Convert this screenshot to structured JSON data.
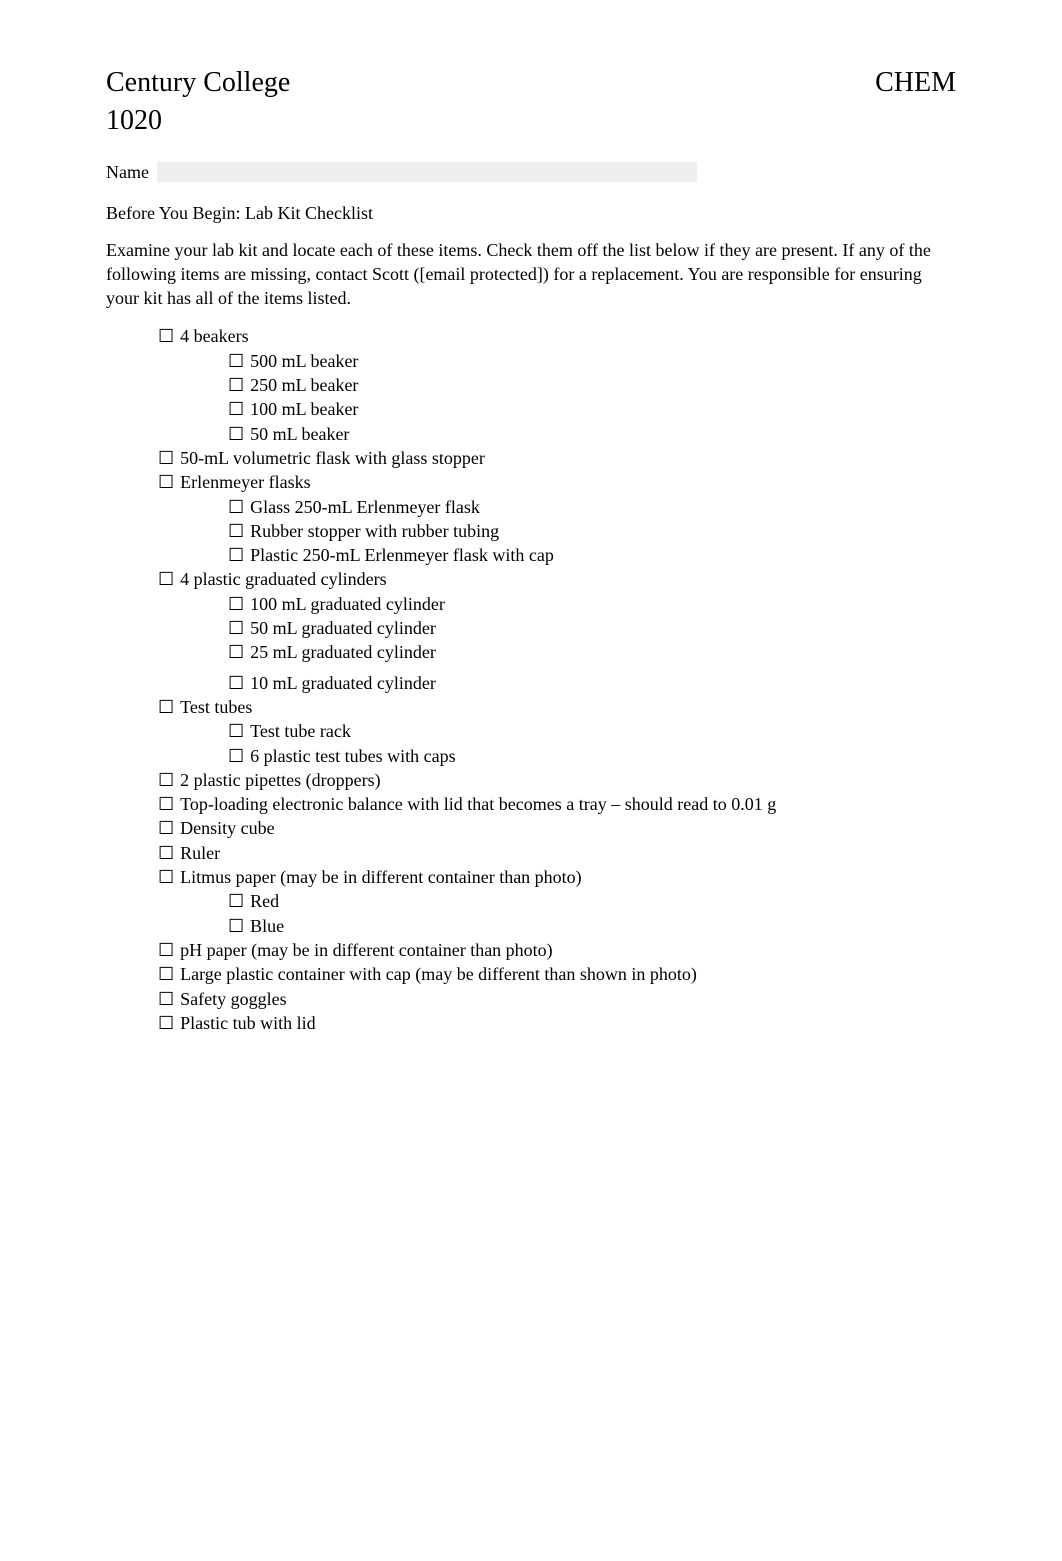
{
  "header": {
    "college": "Century College",
    "course_prefix": "CHEM",
    "course_number": "1020"
  },
  "name_label": "Name",
  "subtitle": "Before You Begin: Lab Kit Checklist",
  "intro": "Examine your lab kit and locate each of these items. Check them off the list below if they are present. If any of the following items are missing, contact Scott ([email protected]) for a replacement. You are responsible for ensuring your kit has all of the items listed.",
  "checklist": [
    {
      "level": 1,
      "label": "4 beakers"
    },
    {
      "level": 2,
      "label": "500 mL beaker"
    },
    {
      "level": 2,
      "label": "250 mL beaker"
    },
    {
      "level": 2,
      "label": "100 mL beaker"
    },
    {
      "level": 2,
      "label": "50 mL beaker"
    },
    {
      "level": 1,
      "label": "50-mL volumetric flask with glass stopper"
    },
    {
      "level": 1,
      "label": "Erlenmeyer flasks"
    },
    {
      "level": 2,
      "label": "Glass 250-mL Erlenmeyer flask"
    },
    {
      "level": 2,
      "label": "Rubber stopper with rubber tubing"
    },
    {
      "level": 2,
      "label": "Plastic 250-mL Erlenmeyer flask with cap"
    },
    {
      "level": 1,
      "label": "4 plastic graduated cylinders"
    },
    {
      "level": 2,
      "label": "100 mL graduated cylinder"
    },
    {
      "level": 2,
      "label": "50 mL graduated cylinder"
    },
    {
      "level": 2,
      "label": "25 mL graduated cylinder"
    },
    {
      "level": 2,
      "label": "10 mL graduated cylinder",
      "gap": true
    },
    {
      "level": 1,
      "label": "Test tubes"
    },
    {
      "level": 2,
      "label": "Test tube rack"
    },
    {
      "level": 2,
      "label": "6 plastic test tubes with caps"
    },
    {
      "level": 1,
      "label": "2 plastic pipettes (droppers)"
    },
    {
      "level": 1,
      "label": "Top-loading electronic balance with lid that becomes a tray – should read to 0.01 g"
    },
    {
      "level": 1,
      "label": "Density cube"
    },
    {
      "level": 1,
      "label": "Ruler"
    },
    {
      "level": 1,
      "label": "Litmus paper (may be in different container than photo)"
    },
    {
      "level": 2,
      "label": "Red"
    },
    {
      "level": 2,
      "label": "Blue"
    },
    {
      "level": 1,
      "label": "pH paper (may be in different container than photo)"
    },
    {
      "level": 1,
      "label": "Large plastic container with cap (may be different than shown in photo)"
    },
    {
      "level": 1,
      "label": "Safety goggles"
    },
    {
      "level": 1,
      "label": "Plastic tub with lid"
    }
  ],
  "checkbox_glyph": "☐"
}
